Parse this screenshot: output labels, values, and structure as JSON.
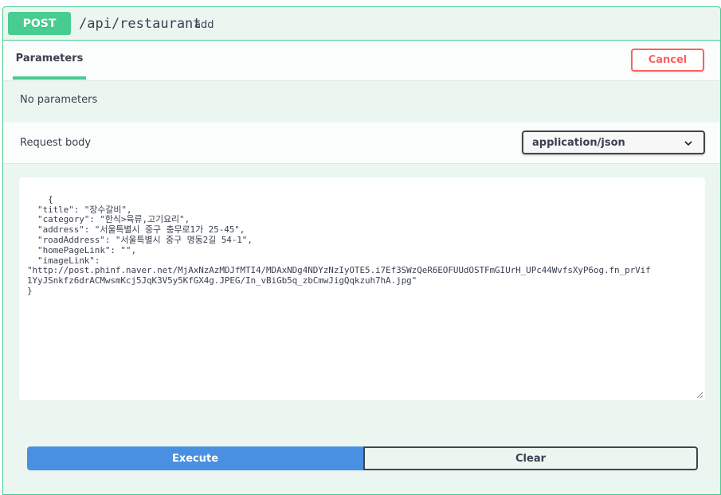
{
  "operation": {
    "method": "POST",
    "path": "/api/restaurant",
    "description": "add"
  },
  "parameters": {
    "tab_label": "Parameters",
    "cancel_label": "Cancel",
    "empty_text": "No parameters"
  },
  "request_body": {
    "label": "Request body",
    "content_type": "application/json",
    "editor_text": "{\n  \"title\": \"장수갈비\",\n  \"category\": \"한식>육류,고기요리\",\n  \"address\": \"서울특별시 중구 충무로1가 25-45\",\n  \"roadAddress\": \"서울특별시 중구 명동2길 54-1\",\n  \"homePageLink\": \"\",\n  \"imageLink\":\n\"http://post.phinf.naver.net/MjAxNzAzMDJfMTI4/MDAxNDg4NDYzNzIyOTE5.i7Ef3SWzQeR6EOFUUdOSTFmGIUrH_UPc44WvfsXyP6og.fn_prVif\n1YyJSnkfz6drACMwsmKcj5JqK3V5y5KfGX4g.JPEG/In_vBiGb5q_zbCmwJigQqkzuh7hA.jpg\"\n}"
  },
  "actions": {
    "execute_label": "Execute",
    "clear_label": "Clear"
  },
  "colors": {
    "post_green": "#49cc90",
    "block_background": "#ebf6f1",
    "cancel_red": "#ff6060",
    "execute_blue": "#4990e2"
  },
  "icons": {
    "select_chevron": "chevron-down-icon",
    "editor_resize": "resize-grip-icon"
  }
}
